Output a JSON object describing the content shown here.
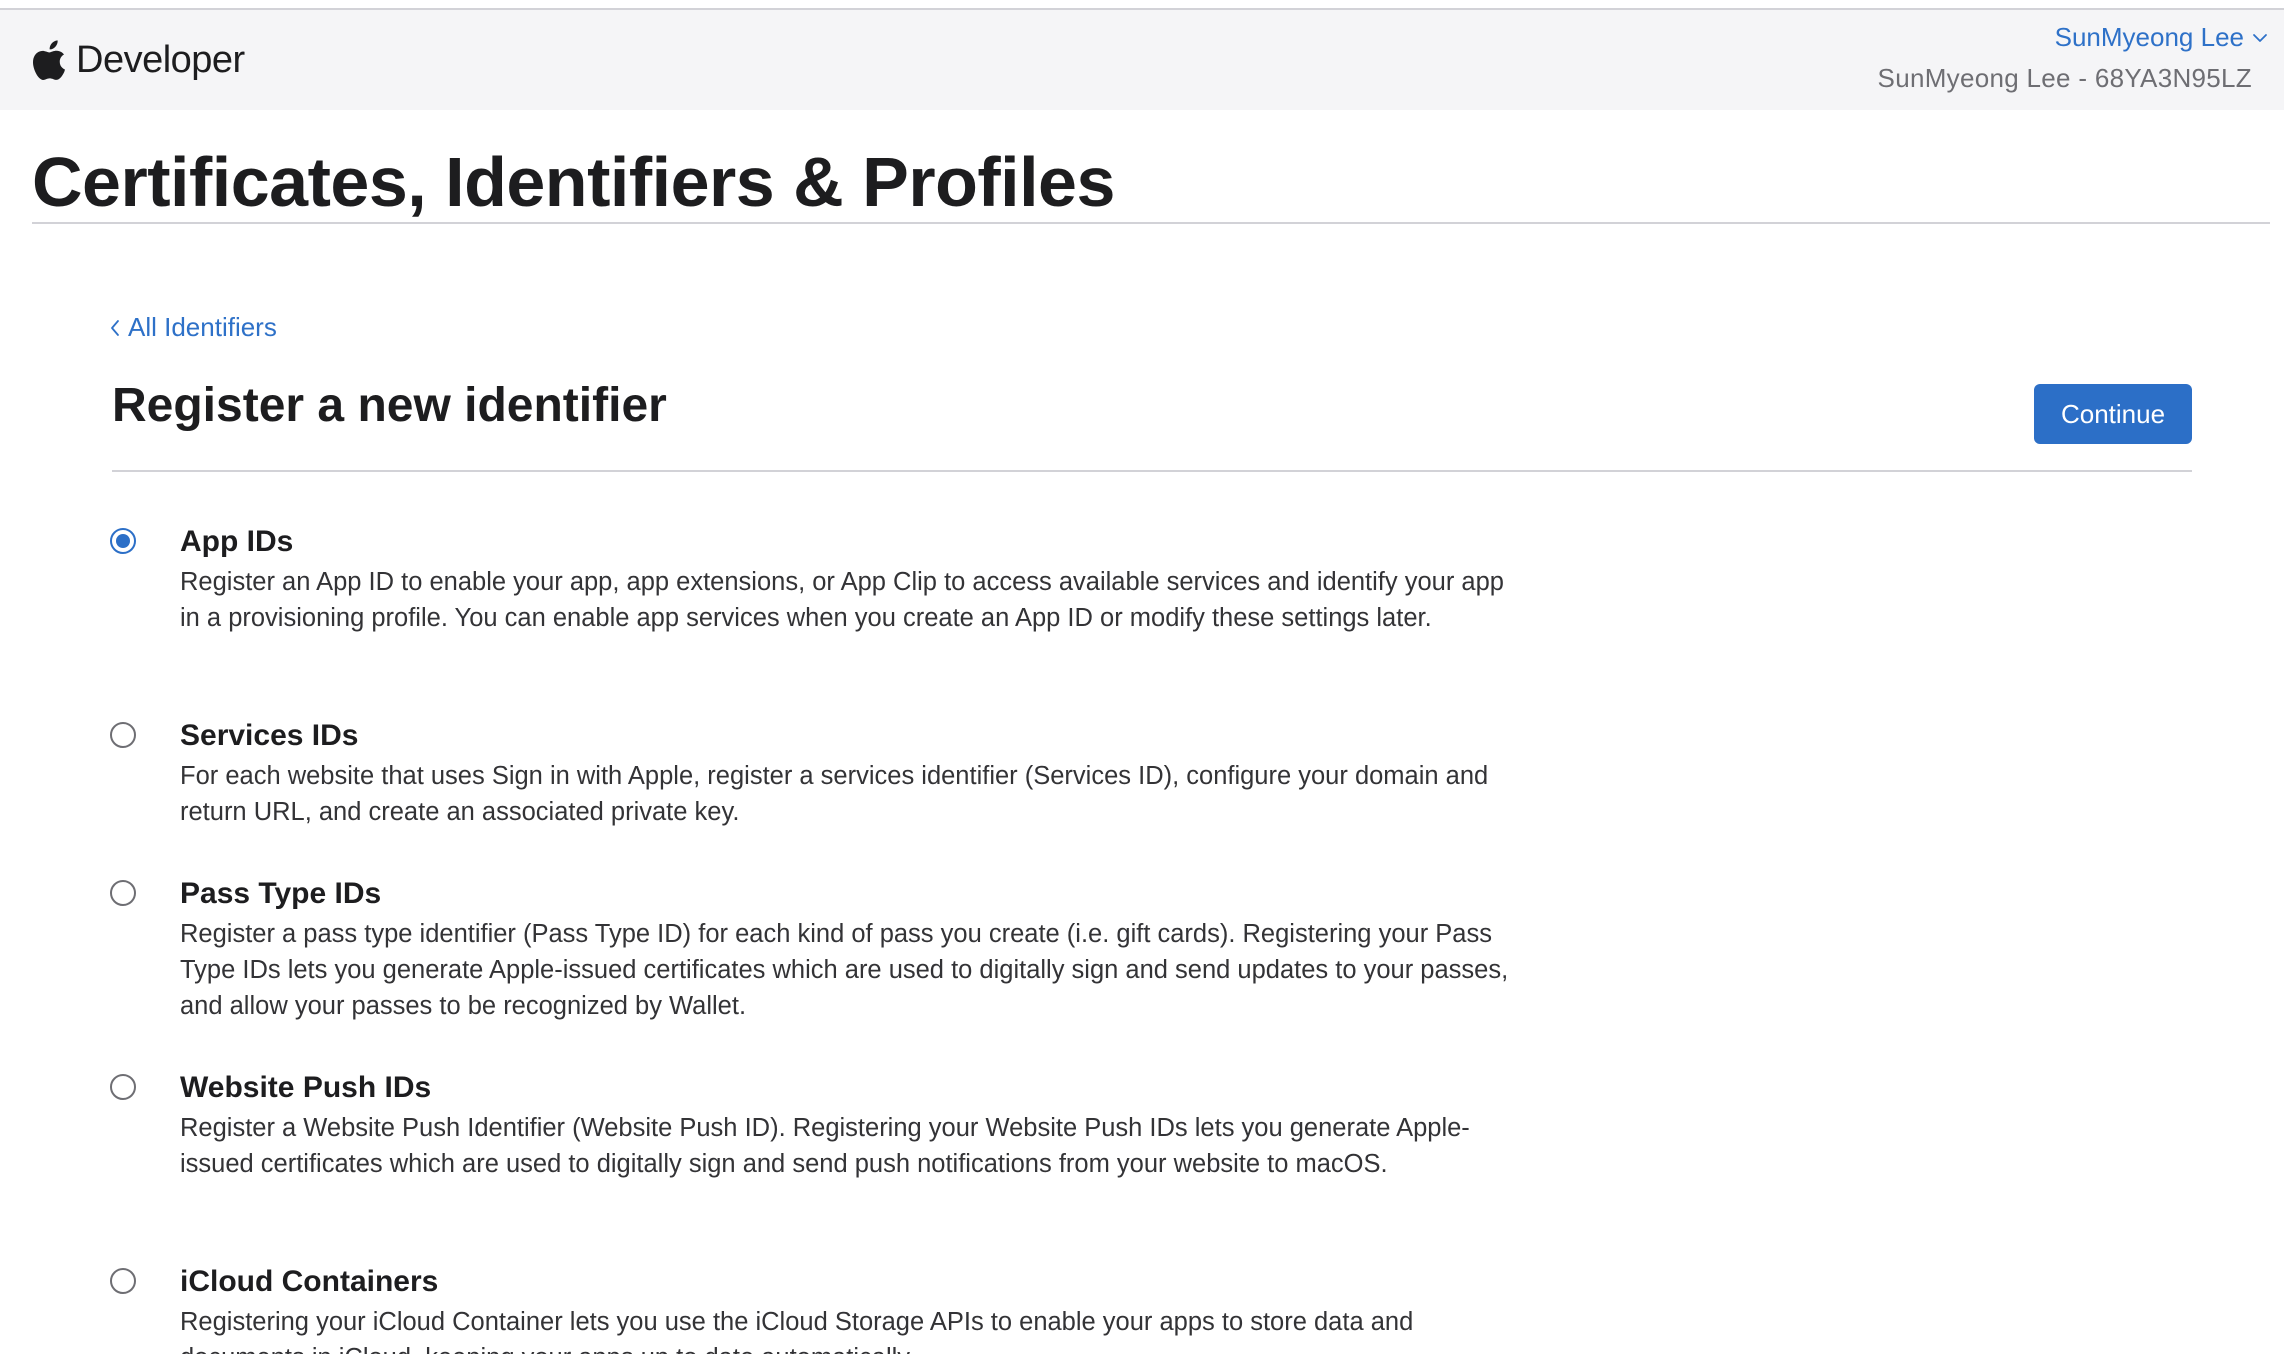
{
  "header": {
    "brand": "Developer",
    "account_name": "SunMyeong Lee",
    "team": "SunMyeong Lee - 68YA3N95LZ"
  },
  "page": {
    "title": "Certificates, Identifiers & Profiles"
  },
  "main": {
    "back_link": "All Identifiers",
    "heading": "Register a new identifier",
    "continue_label": "Continue",
    "selected_option": "App IDs",
    "options": [
      {
        "title": "App IDs",
        "description": "Register an App ID to enable your app, app extensions, or App Clip to access available services and identify your app in a provisioning profile. You can enable app services when you create an App ID or modify these settings later.",
        "selected": true
      },
      {
        "title": "Services IDs",
        "description": "For each website that uses Sign in with Apple, register a services identifier (Services ID), configure your domain and return URL, and create an associated private key.",
        "selected": false
      },
      {
        "title": "Pass Type IDs",
        "description": "Register a pass type identifier (Pass Type ID) for each kind of pass you create (i.e. gift cards). Registering your Pass Type IDs lets you generate Apple-issued certificates which are used to digitally sign and send updates to your passes, and allow your passes to be recognized by Wallet.",
        "selected": false
      },
      {
        "title": "Website Push IDs",
        "description": "Register a Website Push Identifier (Website Push ID). Registering your Website Push IDs lets you generate Apple-issued certificates which are used to digitally sign and send push notifications from your website to macOS.",
        "selected": false
      },
      {
        "title": "iCloud Containers",
        "description": "Registering your iCloud Container lets you use the iCloud Storage APIs to enable your apps to store data and documents in iCloud, keeping your apps up to date automatically.",
        "selected": false
      }
    ]
  },
  "colors": {
    "accent": "#2c6fc7",
    "link": "#2e71c8",
    "nav_background": "#f5f5f7"
  },
  "icons": [
    "apple-logo-icon",
    "chevron-down-icon",
    "chevron-left-icon"
  ]
}
